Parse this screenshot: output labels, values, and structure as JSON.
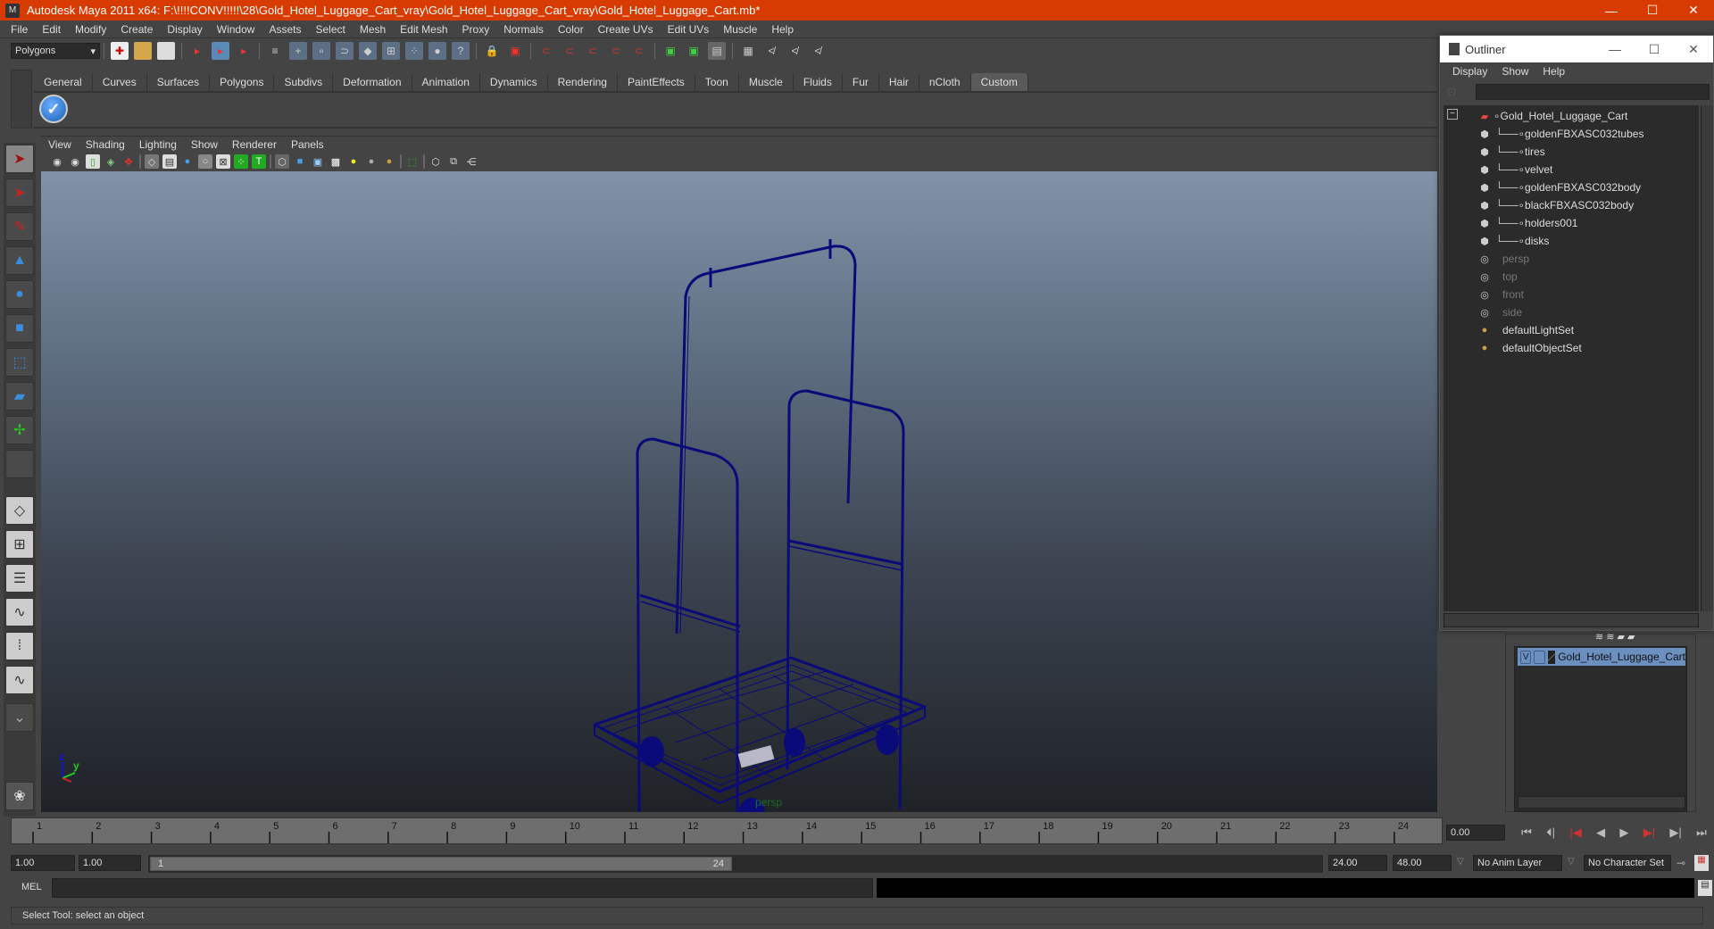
{
  "window": {
    "title": "Autodesk Maya 2011 x64: F:\\!!!!CONV!!!!!\\28\\Gold_Hotel_Luggage_Cart_vray\\Gold_Hotel_Luggage_Cart_vray\\Gold_Hotel_Luggage_Cart.mb*",
    "minimize_icon": "—",
    "maximize_icon": "☐",
    "close_icon": "✕"
  },
  "menubar": [
    "File",
    "Edit",
    "Modify",
    "Create",
    "Display",
    "Window",
    "Assets",
    "Select",
    "Mesh",
    "Edit Mesh",
    "Proxy",
    "Normals",
    "Color",
    "Create UVs",
    "Edit UVs",
    "Muscle",
    "Help"
  ],
  "statusline": {
    "mode": "Polygons"
  },
  "shelf": {
    "tabs": [
      "General",
      "Curves",
      "Surfaces",
      "Polygons",
      "Subdivs",
      "Deformation",
      "Animation",
      "Dynamics",
      "Rendering",
      "PaintEffects",
      "Toon",
      "Muscle",
      "Fluids",
      "Fur",
      "Hair",
      "nCloth",
      "Custom"
    ],
    "active_tab": "Custom"
  },
  "toolbox": {
    "tools": [
      "select-tool",
      "lasso-tool",
      "paint-select-tool",
      "move-tool",
      "rotate-tool",
      "scale-tool",
      "universal-manipulator",
      "soft-modification-tool",
      "show-manipulator-tool",
      "last-used-tool"
    ],
    "layouts": [
      "single-perspective-layout",
      "four-view-layout",
      "outliner-persp-layout",
      "persp-graph-layout",
      "hypershade-persp-layout",
      "persp-graph-hypergraph-layout"
    ]
  },
  "viewport": {
    "menu": [
      "View",
      "Shading",
      "Lighting",
      "Show",
      "Renderer",
      "Panels"
    ],
    "camera_label": "persp",
    "axis_labels": {
      "z": "z",
      "y": "y"
    }
  },
  "timeline": {
    "ticks": [
      "1",
      "2",
      "3",
      "4",
      "5",
      "6",
      "7",
      "8",
      "9",
      "10",
      "11",
      "12",
      "13",
      "14",
      "15",
      "16",
      "17",
      "18",
      "19",
      "20",
      "21",
      "22",
      "23",
      "24"
    ],
    "current_time": "0.00",
    "playback_icons": [
      "⏮",
      "⏭",
      "|◀",
      "◀",
      "▶",
      "▶|",
      "▶|",
      "⏭"
    ]
  },
  "range": {
    "start_time": "1.00",
    "playback_start": "1.00",
    "slider_start_label": "1",
    "slider_end_label": "24",
    "playback_end": "24.00",
    "end_time": "48.00",
    "anim_layer": "No Anim Layer",
    "character_set": "No Character Set"
  },
  "command_line": {
    "label": "MEL",
    "value": ""
  },
  "help_line": "Select Tool: select an object",
  "outliner": {
    "title": "Outliner",
    "menu": [
      "Display",
      "Show",
      "Help"
    ],
    "items": [
      {
        "label": "Gold_Hotel_Luggage_Cart",
        "type": "group",
        "level": 0,
        "dim": false
      },
      {
        "label": "goldenFBXASC032tubes",
        "type": "mesh",
        "level": 1,
        "dim": false
      },
      {
        "label": "tires",
        "type": "mesh",
        "level": 1,
        "dim": false
      },
      {
        "label": "velvet",
        "type": "mesh",
        "level": 1,
        "dim": false
      },
      {
        "label": "goldenFBXASC032body",
        "type": "mesh",
        "level": 1,
        "dim": false
      },
      {
        "label": "blackFBXASC032body",
        "type": "mesh",
        "level": 1,
        "dim": false
      },
      {
        "label": "holders001",
        "type": "mesh",
        "level": 1,
        "dim": false
      },
      {
        "label": "disks",
        "type": "mesh",
        "level": 1,
        "dim": false
      },
      {
        "label": "persp",
        "type": "camera",
        "level": 0,
        "dim": true
      },
      {
        "label": "top",
        "type": "camera",
        "level": 0,
        "dim": true
      },
      {
        "label": "front",
        "type": "camera",
        "level": 0,
        "dim": true
      },
      {
        "label": "side",
        "type": "camera",
        "level": 0,
        "dim": true
      },
      {
        "label": "defaultLightSet",
        "type": "set",
        "level": 0,
        "dim": false
      },
      {
        "label": "defaultObjectSet",
        "type": "set",
        "level": 0,
        "dim": false
      }
    ]
  },
  "layer_editor": {
    "layers": [
      {
        "visible": "V",
        "name": "Gold_Hotel_Luggage_Cart"
      }
    ]
  },
  "colors": {
    "titlebar": "#d83b01",
    "wireframe": "#0a0a78",
    "layer_selected": "#6b8fbe",
    "camera_label": "#1a6e25"
  }
}
